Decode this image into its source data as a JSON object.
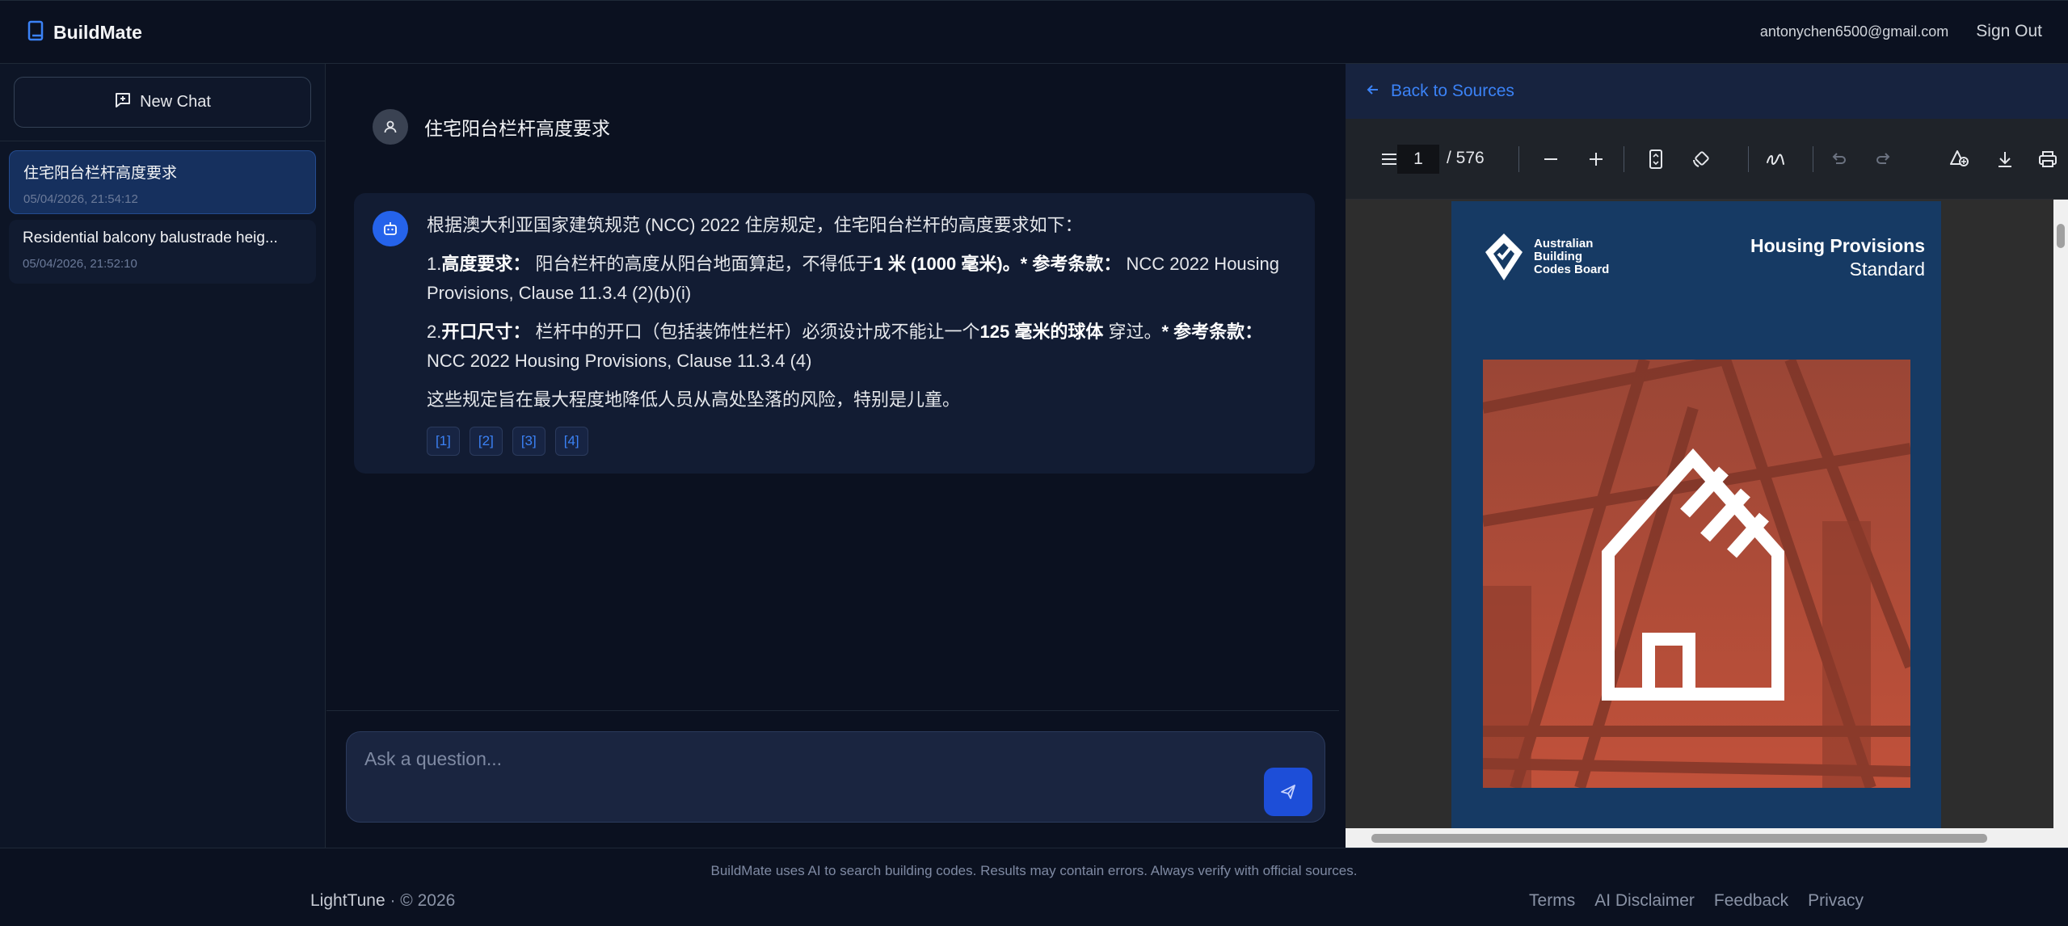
{
  "app": {
    "name": "BuildMate",
    "user_email": "antonychen6500@gmail.com",
    "sign_out": "Sign Out"
  },
  "sidebar": {
    "new_chat": "New Chat",
    "chats": [
      {
        "title": "住宅阳台栏杆高度要求",
        "date": "05/04/2026, 21:54:12",
        "active": true
      },
      {
        "title": "Residential balcony balustrade heig...",
        "date": "05/04/2026, 21:52:10",
        "active": false
      }
    ]
  },
  "chat": {
    "user_question": "住宅阳台栏杆高度要求",
    "answer": {
      "intro": "根据澳大利亚国家建筑规范 (NCC) 2022 住房规定，住宅阳台栏杆的高度要求如下：",
      "item1_num": "1.",
      "item1_label": "高度要求：",
      "item1_text": " 阳台栏杆的高度从阳台地面算起，不得低于",
      "item1_bold": "1 米 (1000 毫米)。",
      "item1_ref_label": "* 参考条款：",
      "item1_ref": " NCC 2022 Housing Provisions, Clause 11.3.4 (2)(b)(i)",
      "item2_num": "2.",
      "item2_label": "开口尺寸：",
      "item2_text": " 栏杆中的开口（包括装饰性栏杆）必须设计成不能让一个",
      "item2_bold": "125 毫米的球体",
      "item2_text2": " 穿过。",
      "item2_ref_label": "* 参考条款：",
      "item2_ref": " NCC 2022 Housing Provisions, Clause 11.3.4 (4)",
      "conclusion": "这些规定旨在最大程度地降低人员从高处坠落的风险，特别是儿童。"
    },
    "citations": [
      "[1]",
      "[2]",
      "[3]",
      "[4]"
    ],
    "input_placeholder": "Ask a question..."
  },
  "viewer": {
    "back_label": "Back to Sources",
    "page_current": "1",
    "page_total": "/ 576",
    "doc": {
      "org_line1": "Australian",
      "org_line2": "Building",
      "org_line3": "Codes Board",
      "title_line1": "Housing Provisions",
      "title_line2": "Standard"
    }
  },
  "footer": {
    "disclaimer": "BuildMate uses AI to search building codes. Results may contain errors. Always verify with official sources.",
    "company": "LightTune",
    "copyright": " · © 2026",
    "links": [
      "Terms",
      "AI Disclaimer",
      "Feedback",
      "Privacy"
    ]
  },
  "colors": {
    "accent": "#3b82f6",
    "background": "#0b1120",
    "card": "#121c33",
    "active_chat": "#16305e"
  }
}
